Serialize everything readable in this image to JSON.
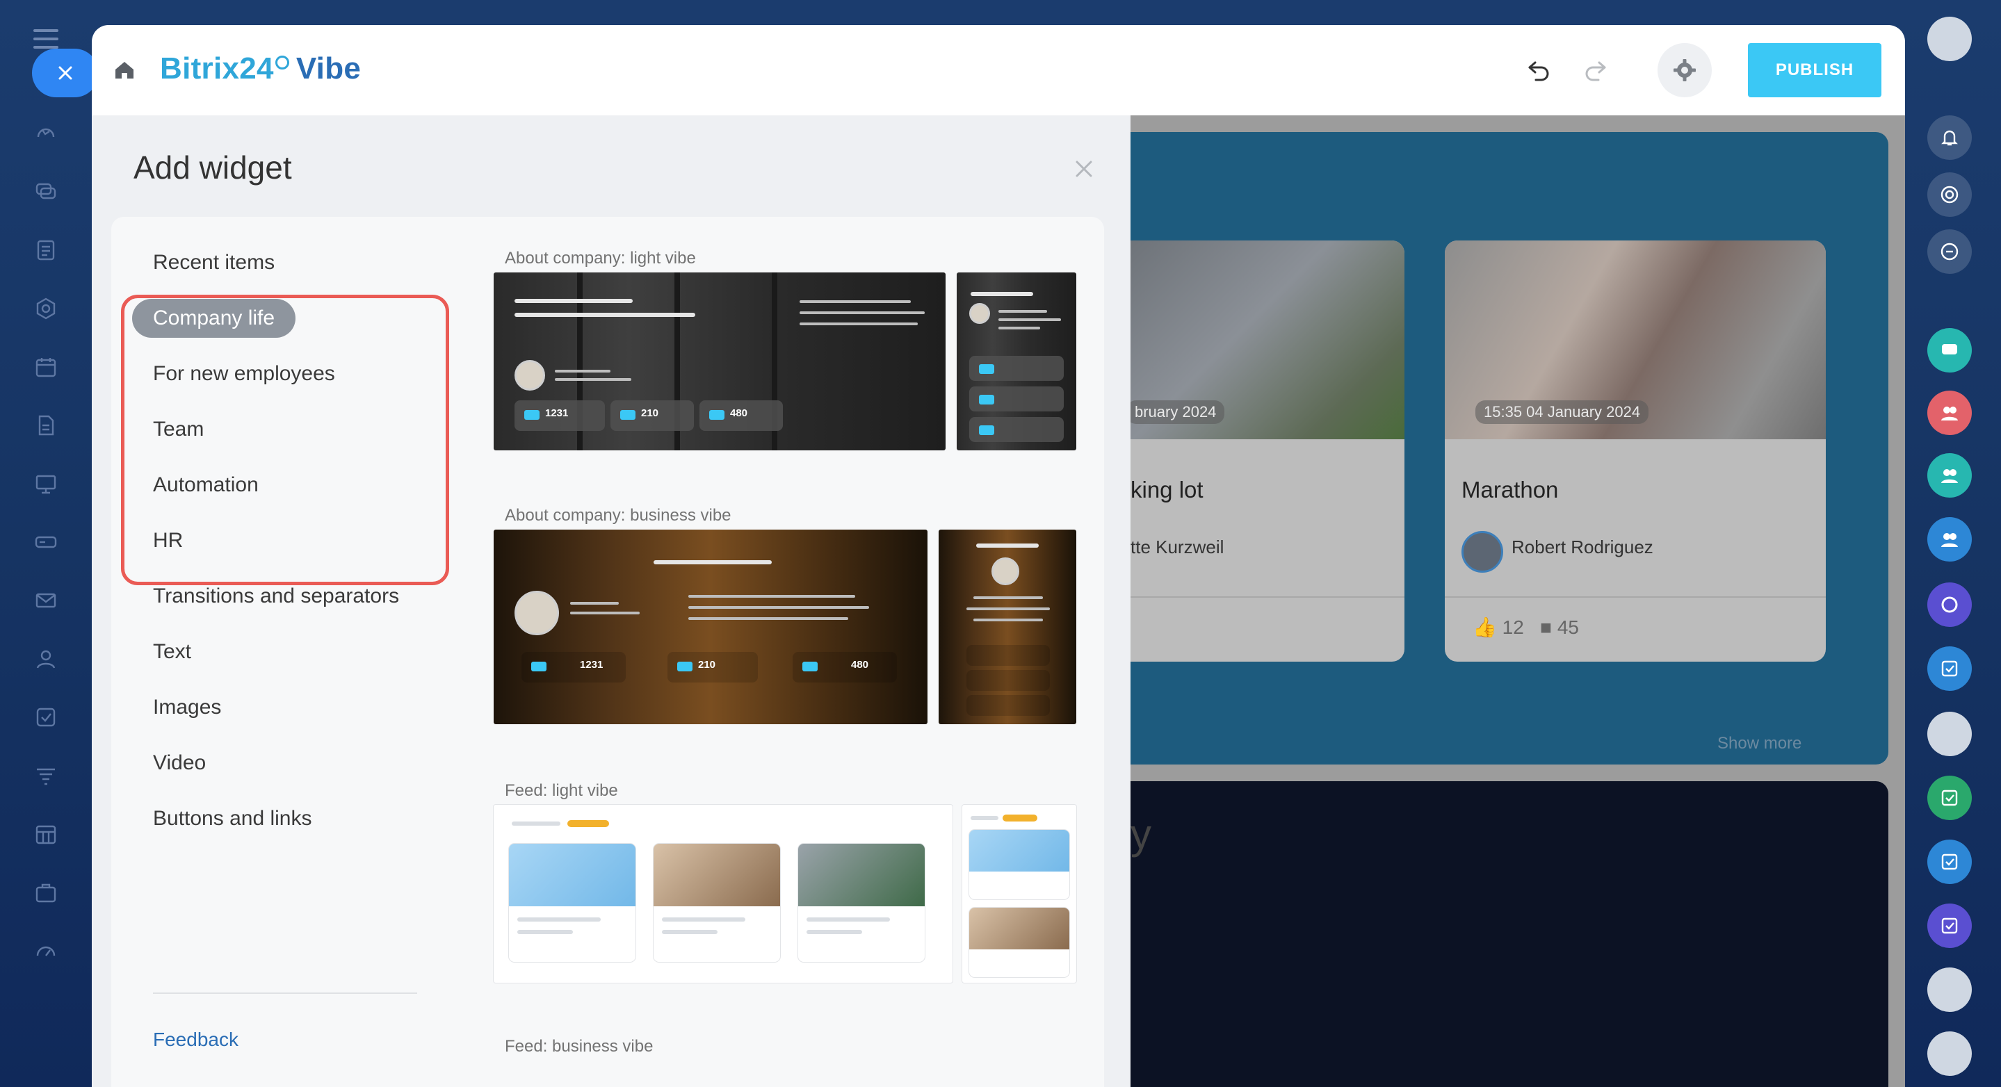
{
  "header": {
    "logo_brand": "Bitrix24",
    "logo_product": "Vibe",
    "publish_label": "PUBLISH"
  },
  "panel": {
    "title": "Add widget",
    "categories": [
      {
        "label": "Recent items"
      },
      {
        "label": "Company life",
        "active": true
      },
      {
        "label": "For new employees"
      },
      {
        "label": "Team"
      },
      {
        "label": "Automation"
      },
      {
        "label": "HR"
      },
      {
        "label": "Transitions and separators"
      },
      {
        "label": "Text"
      },
      {
        "label": "Images"
      },
      {
        "label": "Video"
      },
      {
        "label": "Buttons and links"
      }
    ],
    "feedback_label": "Feedback",
    "previews": [
      {
        "label": "About company: light vibe",
        "stats": [
          "1231",
          "210",
          "480"
        ]
      },
      {
        "label": "About company: business vibe",
        "stats": [
          "1231",
          "210",
          "480"
        ]
      },
      {
        "label": "Feed: light vibe"
      },
      {
        "label": "Feed: business vibe"
      }
    ]
  },
  "background": {
    "cards": [
      {
        "date": "bruary 2024",
        "title": "king lot",
        "author": "tte Kurzweil"
      },
      {
        "date": "15:35 04 January 2024",
        "title": "Marathon",
        "author": "Robert Rodriguez",
        "likes": "12",
        "comments": "45"
      }
    ],
    "show_more": "Show more",
    "partial_heading": "y"
  },
  "colors": {
    "accent": "#3bc8f5",
    "brand": "#2a6db5",
    "highlight": "#ea5b55",
    "active_category": "#8e959e"
  },
  "icons": {
    "left_rail": [
      "menu-icon",
      "close-icon",
      "sites-icon",
      "chat-icon",
      "feed-icon",
      "crm-icon",
      "calendar-icon",
      "documents-icon",
      "presentation-icon",
      "drive-icon",
      "mail-icon",
      "employees-icon",
      "tasks-icon",
      "funnel-icon",
      "calendar-grid-icon",
      "briefcase-icon",
      "gauge-icon"
    ],
    "right_rail": [
      "bell-icon",
      "target-icon",
      "search-chat-icon",
      "chat-team-icon",
      "group-icon",
      "group-icon",
      "group-icon",
      "purple-circle-icon",
      "task-icon",
      "user-avatar",
      "task-icon",
      "task-icon",
      "task-icon",
      "user-avatar",
      "user-avatar"
    ]
  }
}
